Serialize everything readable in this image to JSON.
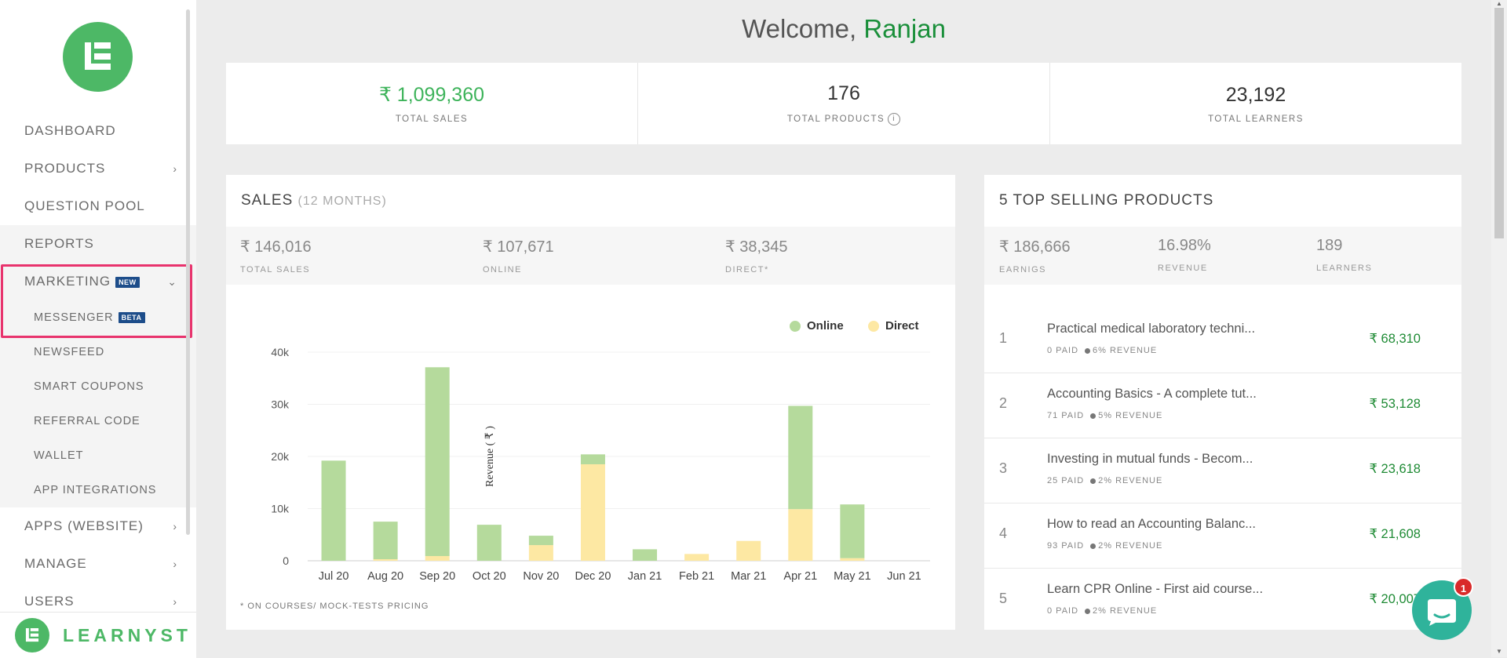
{
  "sidebar": {
    "nav": [
      {
        "label": "DASHBOARD"
      },
      {
        "label": "PRODUCTS",
        "chevron": "›"
      },
      {
        "label": "QUESTION POOL"
      },
      {
        "label": "REPORTS"
      },
      {
        "label": "MARKETING",
        "badge": "NEW",
        "chevron": "⌄"
      }
    ],
    "submenu": [
      {
        "label": "MESSENGER",
        "badge": "BETA"
      },
      {
        "label": "NEWSFEED"
      },
      {
        "label": "SMART COUPONS"
      },
      {
        "label": "REFERRAL CODE"
      },
      {
        "label": "WALLET"
      },
      {
        "label": "APP INTEGRATIONS"
      }
    ],
    "nav_bottom": [
      {
        "label": "APPS (WEBSITE)",
        "chevron": "›"
      },
      {
        "label": "MANAGE",
        "chevron": "›"
      },
      {
        "label": "USERS",
        "chevron": "›"
      }
    ],
    "footer_brand": "LEARNYST"
  },
  "welcome": {
    "prefix": "Welcome, ",
    "name": "Ranjan"
  },
  "stats": [
    {
      "value": "₹ 1,099,360",
      "label": "TOTAL SALES"
    },
    {
      "value": "176",
      "label": "TOTAL PRODUCTS"
    },
    {
      "value": "23,192",
      "label": "TOTAL LEARNERS"
    }
  ],
  "sales_card": {
    "title": "SALES",
    "subtitle": "(12 MONTHS)",
    "sub_stats": [
      {
        "value": "₹ 146,016",
        "label": "TOTAL SALES"
      },
      {
        "value": "₹ 107,671",
        "label": "ONLINE"
      },
      {
        "value": "₹ 38,345",
        "label": "DIRECT*"
      }
    ],
    "footnote": "* ON COURSES/ MOCK-TESTS PRICING"
  },
  "chart_data": {
    "type": "bar",
    "stacked": true,
    "categories": [
      "Jul 20",
      "Aug 20",
      "Sep 20",
      "Oct 20",
      "Nov 20",
      "Dec 20",
      "Jan 21",
      "Feb 21",
      "Mar 21",
      "Apr 21",
      "May 21",
      "Jun 21"
    ],
    "series": [
      {
        "name": "Online",
        "color": "#b5da9c",
        "values": [
          19200,
          7200,
          36200,
          6900,
          1800,
          1900,
          2200,
          0,
          0,
          19800,
          10300,
          0
        ]
      },
      {
        "name": "Direct",
        "color": "#fde8a3",
        "values": [
          0,
          300,
          900,
          0,
          3000,
          18500,
          0,
          1300,
          3800,
          9900,
          500,
          0
        ]
      }
    ],
    "ylabel": "Revenue ( ₹ )",
    "yticks": [
      "0",
      "10k",
      "20k",
      "30k",
      "40k"
    ],
    "ylim": [
      0,
      40000
    ],
    "grid": true,
    "legend": "top-right"
  },
  "top_products": {
    "title": "5 TOP SELLING PRODUCTS",
    "sub_stats": [
      {
        "value": "₹ 186,666",
        "label": "EARNIGS"
      },
      {
        "value": "16.98%",
        "label": "REVENUE"
      },
      {
        "value": "189",
        "label": "LEARNERS"
      }
    ],
    "items": [
      {
        "rank": "1",
        "name": "Practical medical laboratory techni...",
        "paid": "0 PAID",
        "revenue": "6% REVENUE",
        "price": "₹ 68,310"
      },
      {
        "rank": "2",
        "name": "Accounting Basics - A complete tut...",
        "paid": "71 PAID",
        "revenue": "5% REVENUE",
        "price": "₹ 53,128"
      },
      {
        "rank": "3",
        "name": "Investing in mutual funds - Becom...",
        "paid": "25 PAID",
        "revenue": "2% REVENUE",
        "price": "₹ 23,618"
      },
      {
        "rank": "4",
        "name": "How to read an Accounting Balanc...",
        "paid": "93 PAID",
        "revenue": "2% REVENUE",
        "price": "₹ 21,608"
      },
      {
        "rank": "5",
        "name": "Learn CPR Online - First aid course...",
        "paid": "0 PAID",
        "revenue": "2% REVENUE",
        "price": "₹ 20,007"
      }
    ]
  },
  "chat_widget": {
    "badge": "1",
    "icon": "chat-icon"
  },
  "colors": {
    "brand_green": "#4db866",
    "highlight": "#e8336d",
    "badge_blue": "#1d4d8a"
  }
}
